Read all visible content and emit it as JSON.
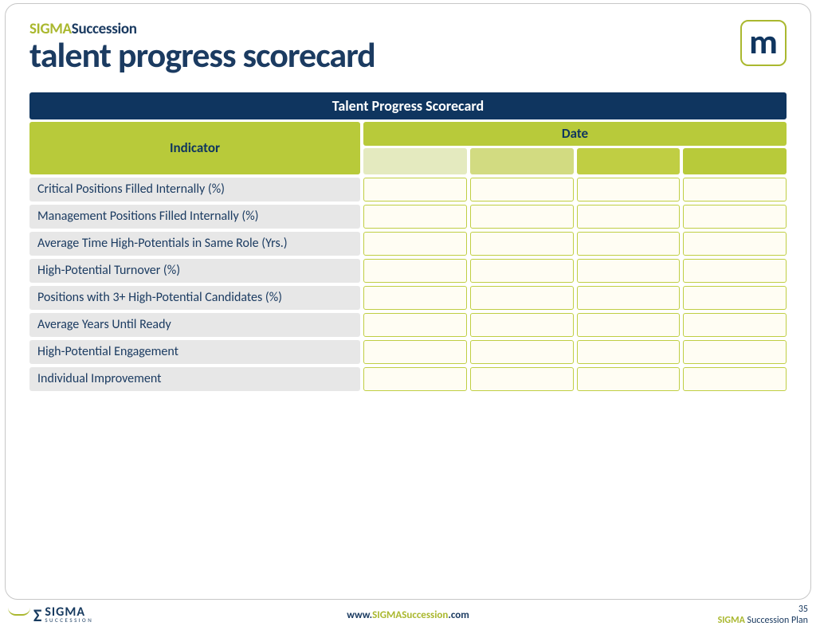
{
  "brand": {
    "line1_sigma": "SIGMA",
    "line1_rest": "Succession",
    "line2": "talent progress scorecard"
  },
  "badge": {
    "letter": "m"
  },
  "table": {
    "title": "Talent Progress Scorecard",
    "indicator_header": "Indicator",
    "date_header": "Date",
    "rows": [
      "Critical Positions Filled Internally (%)",
      "Management Positions Filled Internally (%)",
      "Average Time High-Potentials in Same Role (Yrs.)",
      "High-Potential Turnover (%)",
      "Positions with 3+ High-Potential Candidates (%)",
      "Average Years Until Ready",
      "High-Potential Engagement",
      "Individual Improvement"
    ]
  },
  "footer": {
    "logo_main": "SIGMA",
    "logo_sub": "SUCCESSION",
    "url_www": "www.",
    "url_mid": "SIGMASuccession",
    "url_end": ".com",
    "page_number": "35",
    "plan_sigma": "SIGMA",
    "plan_rest": " Succession Plan"
  }
}
